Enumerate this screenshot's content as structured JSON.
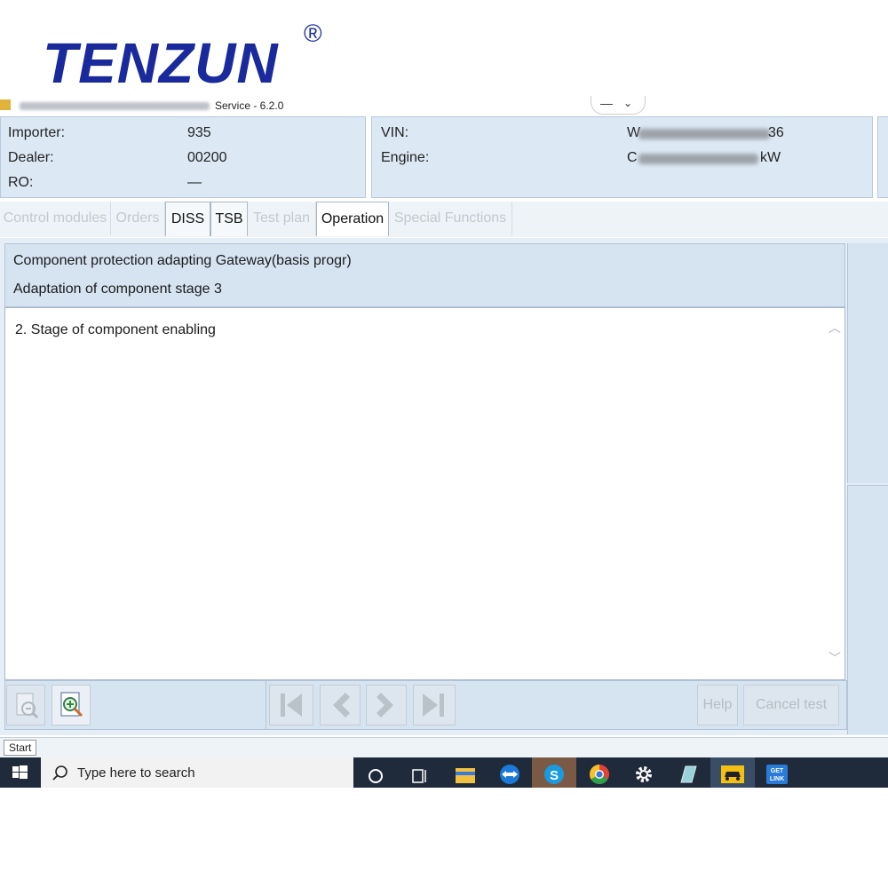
{
  "brand": {
    "logo_text": "TENZUN",
    "registered_mark": "®"
  },
  "window": {
    "title_suffix": "Service - 6.2.0",
    "controls": {
      "minimize": "—",
      "dropdown": "⌄"
    }
  },
  "info_left": {
    "importer_label": "Importer:",
    "importer_value": "935",
    "dealer_label": "Dealer:",
    "dealer_value": "00200",
    "ro_label": "RO:",
    "ro_value": "—"
  },
  "info_right": {
    "vin_label": "VIN:",
    "vin_value_start": "W",
    "vin_value_end": "36",
    "engine_label": "Engine:",
    "engine_value_start": "C",
    "engine_value_end": "kW"
  },
  "tabs": [
    {
      "label": "Control modules",
      "state": "disabled"
    },
    {
      "label": "Orders",
      "state": "disabled"
    },
    {
      "label": "DISS",
      "state": "enabled"
    },
    {
      "label": "TSB",
      "state": "enabled"
    },
    {
      "label": "Test plan",
      "state": "disabled"
    },
    {
      "label": "Operation",
      "state": "selected"
    },
    {
      "label": "Special Functions",
      "state": "disabled"
    }
  ],
  "header": {
    "line1": "Component protection adapting Gateway(basis progr)",
    "line2": "Adaptation of component stage 3"
  },
  "content": {
    "text": "2. Stage of component enabling"
  },
  "toolbar": {
    "zoom_out_icon": "zoom-out-icon",
    "zoom_in_icon": "zoom-in-icon",
    "nav_icons": [
      "skip-first-icon",
      "previous-icon",
      "next-icon",
      "skip-last-icon"
    ],
    "help_label": "Help",
    "cancel_label": "Cancel test"
  },
  "startbar": {
    "start_label": "Start"
  },
  "taskbar": {
    "search_placeholder": "Type here to search",
    "apps": [
      "cortana-icon",
      "task-view-icon",
      "file-explorer-icon",
      "teamviewer-icon",
      "skype-icon",
      "chrome-icon",
      "settings-icon",
      "app-icon",
      "diagnostic-car-icon",
      "getlink-icon"
    ],
    "getlink_text": "GET LINK"
  },
  "colors": {
    "brand": "#1a2a9c",
    "panel": "#dce9f5",
    "taskbar": "#1f2a3a"
  }
}
